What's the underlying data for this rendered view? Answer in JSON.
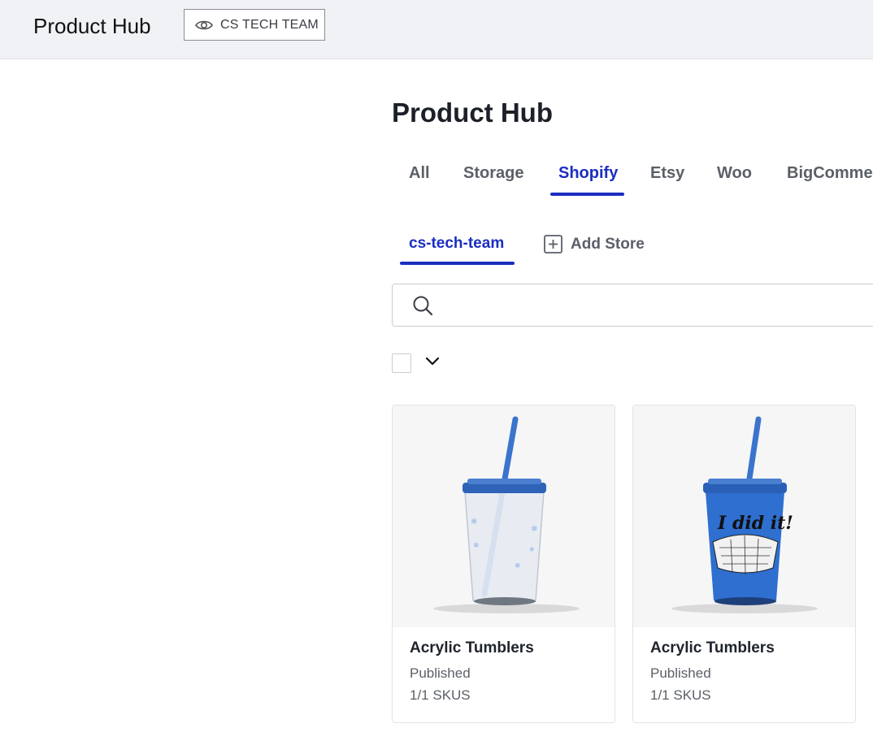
{
  "header": {
    "app_title": "Product Hub",
    "team_label": "CS TECH TEAM",
    "team_icon": "eye-icon"
  },
  "main": {
    "title": "Product Hub",
    "tabs": [
      {
        "label": "All",
        "active": false
      },
      {
        "label": "Storage",
        "active": false
      },
      {
        "label": "Shopify",
        "active": true
      },
      {
        "label": "Etsy",
        "active": false
      },
      {
        "label": "Woo",
        "active": false
      },
      {
        "label": "BigCommerce",
        "active": false
      }
    ],
    "store_tabs": {
      "active_store": "cs-tech-team",
      "add_store_label": "Add Store"
    },
    "search": {
      "placeholder": "",
      "value": ""
    },
    "products": [
      {
        "name": "Acrylic Tumblers",
        "status": "Published",
        "skus": "1/1 SKUS",
        "variant": "clear"
      },
      {
        "name": "Acrylic Tumblers",
        "status": "Published",
        "skus": "1/1 SKUS",
        "variant": "blue",
        "print_text": "I did it!"
      }
    ]
  },
  "colors": {
    "accent": "#1b2ec0",
    "topbar_bg": "#f1f2f5",
    "tumbler_blue": "#2e6fd0"
  }
}
